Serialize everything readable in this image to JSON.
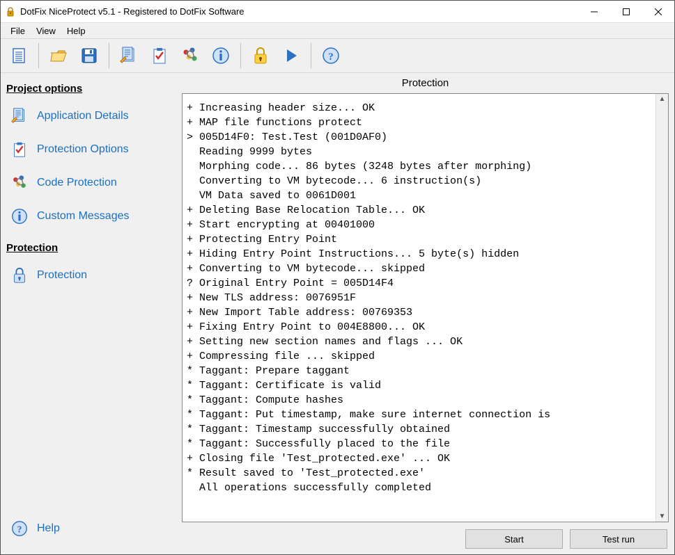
{
  "titlebar": {
    "title": "DotFix NiceProtect v5.1 - Registered to DotFix Software"
  },
  "menubar": {
    "file": "File",
    "view": "View",
    "help": "Help"
  },
  "toolbar": {
    "new": "New",
    "open": "Open",
    "save": "Save",
    "app_details": "Application Details",
    "protection_options": "Protection Options",
    "code_protection": "Code Protection",
    "custom_messages": "Custom Messages",
    "protection": "Protection",
    "run": "Run",
    "help": "Help"
  },
  "sidebar": {
    "heading_project": "Project options",
    "heading_protection": "Protection",
    "items": {
      "app_details": "Application Details",
      "protection_options": "Protection Options",
      "code_protection": "Code Protection",
      "custom_messages": "Custom Messages",
      "protection": "Protection",
      "help": "Help"
    }
  },
  "content": {
    "title": "Protection",
    "log": "+ Increasing header size... OK\n+ MAP file functions protect\n> 005D14F0: Test.Test (001D0AF0)\n  Reading 9999 bytes\n  Morphing code... 86 bytes (3248 bytes after morphing)\n  Converting to VM bytecode... 6 instruction(s)\n  VM Data saved to 0061D001\n+ Deleting Base Relocation Table... OK\n+ Start encrypting at 00401000\n+ Protecting Entry Point\n+ Hiding Entry Point Instructions... 5 byte(s) hidden\n+ Converting to VM bytecode... skipped\n? Original Entry Point = 005D14F4\n+ New TLS address: 0076951F\n+ New Import Table address: 00769353\n+ Fixing Entry Point to 004E8800... OK\n+ Setting new section names and flags ... OK\n+ Compressing file ... skipped\n* Taggant: Prepare taggant\n* Taggant: Certificate is valid\n* Taggant: Compute hashes\n* Taggant: Put timestamp, make sure internet connection is\n* Taggant: Timestamp successfully obtained\n* Taggant: Successfully placed to the file\n+ Closing file 'Test_protected.exe' ... OK\n* Result saved to 'Test_protected.exe'\n  All operations successfully completed",
    "buttons": {
      "start": "Start",
      "test_run": "Test run"
    }
  }
}
